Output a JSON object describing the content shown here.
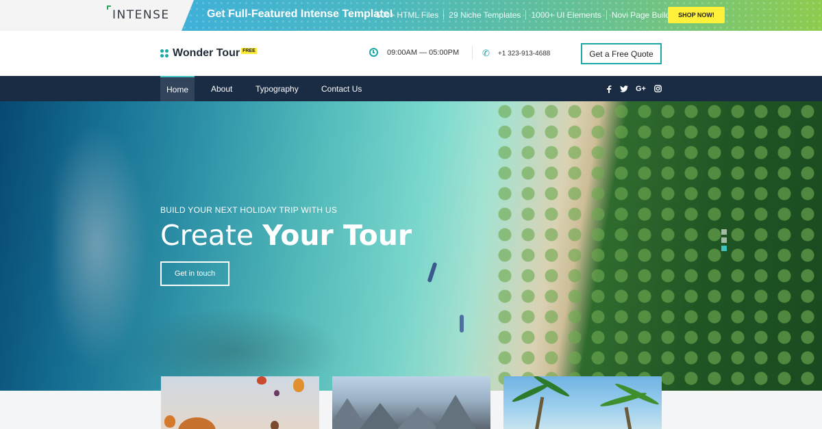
{
  "promo": {
    "logo": "INTENSE",
    "headline": "Get Full-Featured Intense Template!",
    "features": [
      "500+ HTML Files",
      "29 Niche Templates",
      "1000+ UI Elements",
      "Novi Page Builder"
    ],
    "cta": "SHOP NOW!"
  },
  "header": {
    "brand": "Wonder Tour",
    "badge": "FREE",
    "hours": "09:00AM — 05:00PM",
    "phone": "+1 323-913-4688",
    "quote_button": "Get a Free Quote",
    "icons": [
      "clock-icon",
      "phone-icon"
    ]
  },
  "nav": {
    "items": [
      {
        "label": "Home",
        "active": true
      },
      {
        "label": "About",
        "active": false
      },
      {
        "label": "Typography",
        "active": false
      },
      {
        "label": "Contact Us",
        "active": false
      }
    ],
    "social": [
      "facebook-icon",
      "twitter-icon",
      "google-plus-icon",
      "instagram-icon"
    ]
  },
  "hero": {
    "subtitle": "BUILD YOUR NEXT HOLIDAY TRIP WITH US",
    "title_light": "Create ",
    "title_bold": "Your Tour",
    "button": "Get in touch",
    "slides": 3,
    "active_slide": 3
  },
  "colors": {
    "accent": "#19a7a7",
    "nav_bg": "#1a2b44",
    "promo_button": "#fff03a"
  }
}
